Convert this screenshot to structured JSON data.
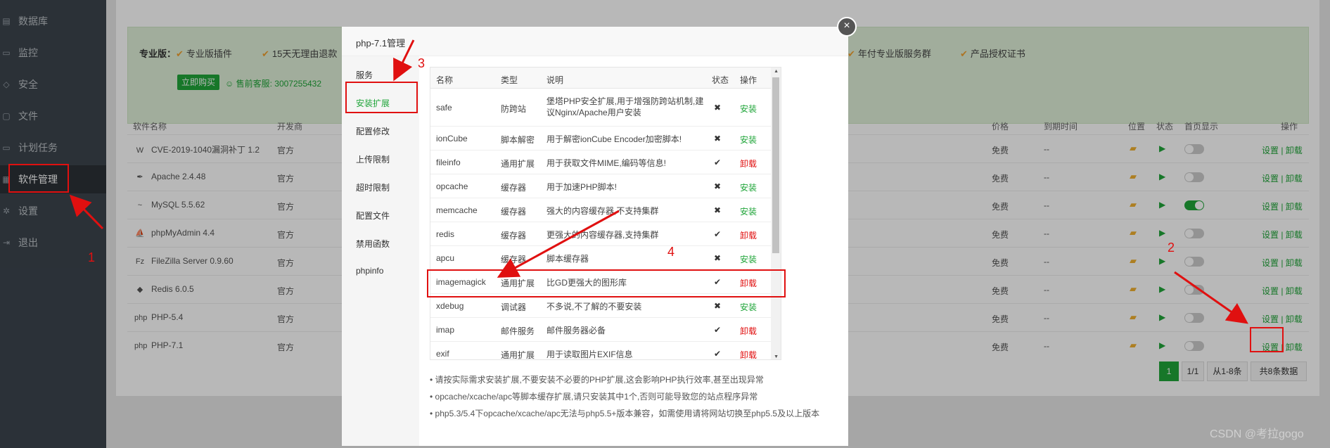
{
  "sidebar": {
    "items": [
      {
        "label": "数据库",
        "icon": "database-icon"
      },
      {
        "label": "监控",
        "icon": "monitor-icon"
      },
      {
        "label": "安全",
        "icon": "shield-icon"
      },
      {
        "label": "文件",
        "icon": "folder-icon"
      },
      {
        "label": "计划任务",
        "icon": "clock-icon"
      },
      {
        "label": "软件管理",
        "icon": "grid-icon"
      },
      {
        "label": "设置",
        "icon": "gear-icon"
      },
      {
        "label": "退出",
        "icon": "logout-icon"
      }
    ]
  },
  "pro": {
    "label": "专业版：",
    "features": [
      "专业版插件",
      "15天无理由退款",
      "年付专业版服务群",
      "产品授权证书"
    ],
    "buy": "立即购买",
    "qq": "售前客服: 3007255432"
  },
  "table": {
    "headers": {
      "name": "软件名称",
      "dev": "开发商",
      "price": "价格",
      "expire": "到期时间",
      "pos": "位置",
      "status": "状态",
      "home": "首页显示",
      "ops": "操作"
    },
    "rows": [
      {
        "name": "CVE-2019-1040漏洞补丁 1.2",
        "dev": "官方",
        "price": "免费",
        "expire": "--",
        "home_on": false,
        "ops": "设置 | 卸载",
        "icon": "waf-icon"
      },
      {
        "name": "Apache 2.4.48",
        "dev": "官方",
        "price": "免费",
        "expire": "--",
        "home_on": false,
        "ops": "设置 | 卸载",
        "icon": "feather-icon"
      },
      {
        "name": "MySQL 5.5.62",
        "dev": "官方",
        "price": "免费",
        "expire": "--",
        "home_on": true,
        "ops": "设置 | 卸载",
        "icon": "dolphin-icon"
      },
      {
        "name": "phpMyAdmin 4.4",
        "dev": "官方",
        "price": "免费",
        "expire": "--",
        "home_on": false,
        "ops": "设置 | 卸载",
        "icon": "sail-icon"
      },
      {
        "name": "FileZilla Server 0.9.60",
        "dev": "官方",
        "price": "免费",
        "expire": "--",
        "home_on": false,
        "ops": "设置 | 卸载",
        "icon": "filezilla-icon"
      },
      {
        "name": "Redis 6.0.5",
        "dev": "官方",
        "price": "免费",
        "expire": "--",
        "home_on": false,
        "ops": "设置 | 卸载",
        "icon": "redis-icon"
      },
      {
        "name": "PHP-5.4",
        "dev": "官方",
        "price": "免费",
        "expire": "--",
        "home_on": false,
        "ops": "设置 | 卸载",
        "icon": "php-icon"
      },
      {
        "name": "PHP-7.1",
        "dev": "官方",
        "price": "免费",
        "expire": "--",
        "home_on": false,
        "ops": "设置 | 卸载",
        "icon": "php-icon"
      }
    ]
  },
  "pager": {
    "current": "1",
    "total": "1/1",
    "range": "从1-8条",
    "count": "共8条数据"
  },
  "dialog": {
    "title": "php-7.1管理",
    "close": "×",
    "nav": [
      "服务",
      "安装扩展",
      "配置修改",
      "上传限制",
      "超时限制",
      "配置文件",
      "禁用函数",
      "phpinfo"
    ],
    "ext_headers": {
      "name": "名称",
      "type": "类型",
      "desc": "说明",
      "status": "状态",
      "op": "操作"
    },
    "extensions": [
      {
        "name": "safe",
        "type": "防跨站",
        "desc": "堡塔PHP安全扩展,用于增强防跨站机制,建议Nginx/Apache用户安装",
        "installed": false,
        "op": "安装"
      },
      {
        "name": "ionCube",
        "type": "脚本解密",
        "desc": "用于解密ionCube Encoder加密脚本!",
        "installed": false,
        "op": "安装"
      },
      {
        "name": "fileinfo",
        "type": "通用扩展",
        "desc": "用于获取文件MIME,编码等信息!",
        "installed": true,
        "op": "卸载"
      },
      {
        "name": "opcache",
        "type": "缓存器",
        "desc": "用于加速PHP脚本!",
        "installed": false,
        "op": "安装"
      },
      {
        "name": "memcache",
        "type": "缓存器",
        "desc": "强大的内容缓存器,不支持集群",
        "installed": false,
        "op": "安装"
      },
      {
        "name": "redis",
        "type": "缓存器",
        "desc": "更强大的内容缓存器,支持集群",
        "installed": true,
        "op": "卸载"
      },
      {
        "name": "apcu",
        "type": "缓存器",
        "desc": "脚本缓存器",
        "installed": false,
        "op": "安装"
      },
      {
        "name": "imagemagick",
        "type": "通用扩展",
        "desc": "比GD更强大的图形库",
        "installed": true,
        "op": "卸载"
      },
      {
        "name": "xdebug",
        "type": "调试器",
        "desc": "不多说,不了解的不要安装",
        "installed": false,
        "op": "安装"
      },
      {
        "name": "imap",
        "type": "邮件服务",
        "desc": "邮件服务器必备",
        "installed": true,
        "op": "卸载"
      },
      {
        "name": "exif",
        "type": "通用扩展",
        "desc": "用于读取图片EXIF信息",
        "installed": true,
        "op": "卸载"
      }
    ],
    "notes": [
      "请按实际需求安装扩展,不要安装不必要的PHP扩展,这会影响PHP执行效率,甚至出现异常",
      "opcache/xcache/apc等脚本缓存扩展,请只安装其中1个,否则可能导致您的站点程序异常",
      "php5.3/5.4下opcache/xcache/apc无法与php5.5+版本兼容，如需使用请将网站切换至php5.5及以上版本"
    ]
  },
  "annotations": {
    "n1": "1",
    "n2": "2",
    "n3": "3",
    "n4": "4"
  },
  "watermark": "CSDN @考拉gogo",
  "colors": {
    "accent": "#20a53a",
    "annotation": "#e01010",
    "sidebar": "#3c444d"
  }
}
